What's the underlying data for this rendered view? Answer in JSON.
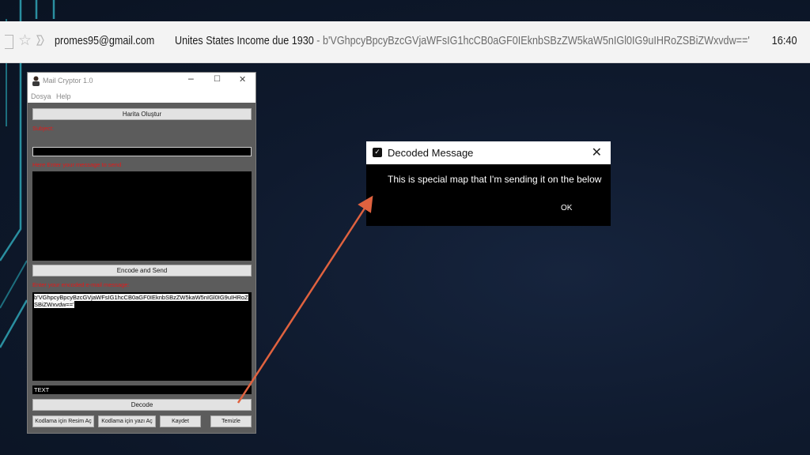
{
  "mail_row": {
    "sender": "promes95@gmail.com",
    "subject": "Unites States Income due 1930",
    "snippet": " - b'VGhpcyBpcyBzcGVjaWFsIG1hcCB0aGF0IEknbSBzZW5kaW5nIGl0IG9uIHRoZSBiZWxvdw=='",
    "time": "16:40"
  },
  "app": {
    "title": "Mail Cryptor 1.0",
    "menu": [
      "Dosya",
      "Help"
    ],
    "map_button": "Harita Oluştur",
    "subject_label": "Subject:",
    "message_label": "Here Enter your message to send",
    "encode_button": "Encode and Send",
    "encoded_label": "Enter your encoded e-mail message:",
    "encoded_text": "b'VGhpcyBpcyBzcGVjaWFsIG1hcCB0aGF0IEknbSBzZW5kaW5nIGl0IG9uIHRoZSBiZWxvdw=='",
    "text_output_label": "TEXT",
    "decode_button": "Decode",
    "bottom_buttons": [
      "Kodlama için Resim Aç",
      "Kodlama için  yazı Aç",
      "Kaydet",
      "Temizle"
    ]
  },
  "dialog": {
    "title": "Decoded Message",
    "message": "This is special map that I'm sending it on the below",
    "ok_label": "OK"
  },
  "colors": {
    "background": "#0f1a2e",
    "accent_line": "#2a8fa0",
    "label_red": "#e21a1a",
    "arrow": "#e0623f"
  }
}
